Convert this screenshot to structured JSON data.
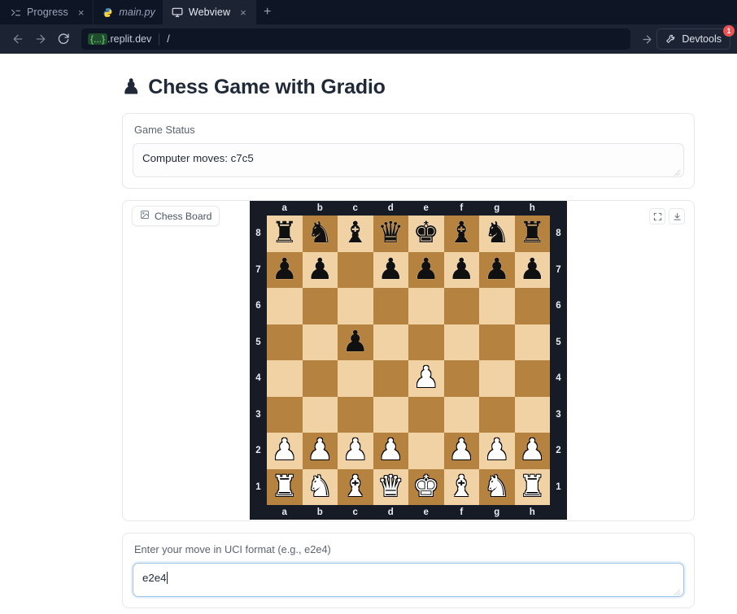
{
  "browser": {
    "tabs": [
      {
        "label": "Progress",
        "icon": "terminal-prompt-icon",
        "active": false,
        "italic": false,
        "closable": true
      },
      {
        "label": "main.py",
        "icon": "python-file-icon",
        "active": false,
        "italic": true,
        "closable": false
      },
      {
        "label": "Webview",
        "icon": "monitor-icon",
        "active": true,
        "italic": false,
        "closable": true
      }
    ],
    "new_tab_label": "+",
    "close_label": "×",
    "nav": {
      "back_icon": "arrow-left-icon",
      "forward_icon": "arrow-right-icon",
      "reload_icon": "reload-icon",
      "go_icon": "arrow-right-icon"
    },
    "address": {
      "host_chip": "{...}",
      "host_domain": ".replit.dev",
      "path": "/"
    },
    "devtools": {
      "label": "Devtools",
      "icon": "wrench-icon",
      "badge": "1"
    }
  },
  "app": {
    "title": "Chess Game with Gradio",
    "title_icon": "♟"
  },
  "status_panel": {
    "label": "Game Status",
    "value": "Computer moves: c7c5"
  },
  "board_panel": {
    "chip_label": "Chess Board",
    "chip_icon": "image-icon",
    "tools": [
      {
        "name": "fullscreen-icon",
        "glyph": "fullscreen"
      },
      {
        "name": "download-icon",
        "glyph": "download"
      }
    ]
  },
  "move_panel": {
    "label": "Enter your move in UCI format (e.g., e2e4)",
    "value": "e2e4",
    "focused": true
  },
  "chess": {
    "files": [
      "a",
      "b",
      "c",
      "d",
      "e",
      "f",
      "g",
      "h"
    ],
    "ranks": [
      "8",
      "7",
      "6",
      "5",
      "4",
      "3",
      "2",
      "1"
    ],
    "fen": "rnbqkbnr/pp1ppppp/8/2p5/4P3/8/PPPP1PPP/RNBQKBNR",
    "last_move": "c7c5",
    "colors": {
      "light_square": "#f0d2a4",
      "dark_square": "#b5823f",
      "border": "#161b26"
    },
    "position": [
      [
        "r",
        "n",
        "b",
        "q",
        "k",
        "b",
        "n",
        "r"
      ],
      [
        "p",
        "p",
        "",
        "p",
        "p",
        "p",
        "p",
        "p"
      ],
      [
        "",
        "",
        "",
        "",
        "",
        "",
        "",
        ""
      ],
      [
        "",
        "",
        "p",
        "",
        "",
        "",
        "",
        ""
      ],
      [
        "",
        "",
        "",
        "",
        "P",
        "",
        "",
        ""
      ],
      [
        "",
        "",
        "",
        "",
        "",
        "",
        "",
        ""
      ],
      [
        "P",
        "P",
        "P",
        "P",
        "",
        "P",
        "P",
        "P"
      ],
      [
        "R",
        "N",
        "B",
        "Q",
        "K",
        "B",
        "N",
        "R"
      ]
    ]
  }
}
